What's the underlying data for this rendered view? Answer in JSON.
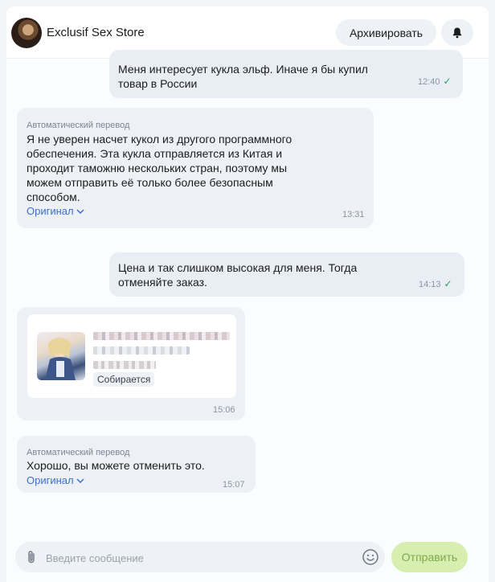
{
  "header": {
    "store_name": "Exclusif Sex Store",
    "archive_label": "Архивировать",
    "bell_icon": "bell-icon"
  },
  "messages": [
    {
      "direction": "out",
      "text": "Меня интересует кукла эльф. Иначе я бы купил\nтовар в России",
      "time": "12:40",
      "read": true
    },
    {
      "direction": "in",
      "auto_translate_label": "Автоматический перевод",
      "text": "Я не уверен насчет кукол из другого программного\nобеспечения. Эта кукла отправляется из Китая и\nпроходит таможню нескольких стран, поэтому мы\nможем отправить её только более безопасным\nспособом.",
      "original_label": "Оригинал",
      "time": "13:31"
    },
    {
      "direction": "out",
      "text": "Цена и так слишком высокая для меня. Тогда\nотменяйте заказ.",
      "time": "14:13",
      "read": true
    },
    {
      "direction": "in",
      "type": "product",
      "status": "Собирается",
      "time": "15:06"
    },
    {
      "direction": "in",
      "auto_translate_label": "Автоматический перевод",
      "text": "Хорошо, вы можете отменить это.",
      "original_label": "Оригинал",
      "time": "15:07"
    }
  ],
  "composer": {
    "placeholder": "Введите сообщение",
    "send_label": "Отправить"
  },
  "colors": {
    "accent": "#3b6fd0",
    "read_check": "#21a35b",
    "send_disabled_bg": "#d6efb0"
  }
}
